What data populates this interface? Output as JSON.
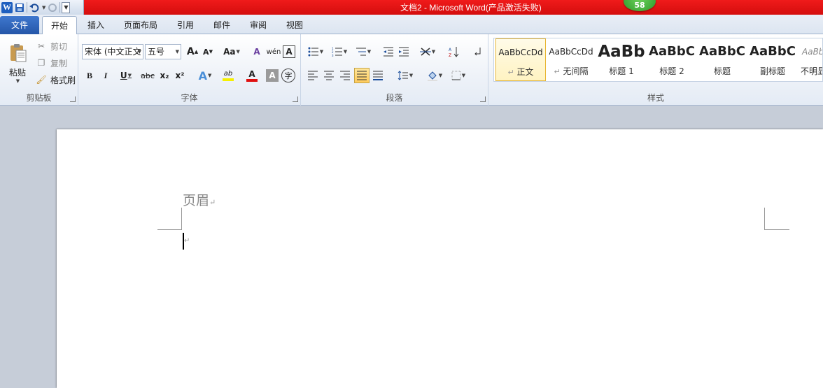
{
  "window": {
    "title": "文档2 - Microsoft Word(产品激活失败)",
    "badge": "58"
  },
  "qat": {
    "word_icon": "W",
    "save_icon": "save-icon",
    "undo_icon": "undo-icon",
    "redo_icon": "redo-icon",
    "customize_icon": "dropdown-icon"
  },
  "tabs": {
    "file": "文件",
    "items": [
      "开始",
      "插入",
      "页面布局",
      "引用",
      "邮件",
      "审阅",
      "视图"
    ],
    "active": "开始"
  },
  "clipboard": {
    "paste": "粘贴",
    "cut": "剪切",
    "copy": "复制",
    "format_painter": "格式刷",
    "label": "剪贴板"
  },
  "font": {
    "name": "宋体 (中文正文",
    "size": "五号",
    "grow": "A",
    "shrink": "A",
    "change_case": "Aa",
    "clear_format": "A",
    "phonetic": "wén",
    "char_border": "A",
    "bold": "B",
    "italic": "I",
    "underline": "U",
    "strikethrough": "abc",
    "subscript": "x₂",
    "superscript": "x²",
    "text_effect": "A",
    "highlight": "ab",
    "font_color": "A",
    "char_shading": "A",
    "enclose": "字",
    "label": "字体",
    "highlight_color": "#f5f000",
    "font_color_value": "#e01010"
  },
  "paragraph": {
    "label": "段落"
  },
  "styles": {
    "items": [
      {
        "sample": "AaBbCcDd",
        "name": "正文",
        "mark": "↵"
      },
      {
        "sample": "AaBbCcDd",
        "name": "无间隔",
        "mark": "↵"
      },
      {
        "sample": "AaBb",
        "name": "标题 1",
        "mark": ""
      },
      {
        "sample": "AaBbC",
        "name": "标题 2",
        "mark": ""
      },
      {
        "sample": "AaBbC",
        "name": "标题",
        "mark": ""
      },
      {
        "sample": "AaBbC",
        "name": "副标题",
        "mark": ""
      },
      {
        "sample": "AaBbC",
        "name": "不明显",
        "mark": ""
      }
    ],
    "label": "样式"
  },
  "document": {
    "header_text": "页眉",
    "para_mark": "↵"
  }
}
